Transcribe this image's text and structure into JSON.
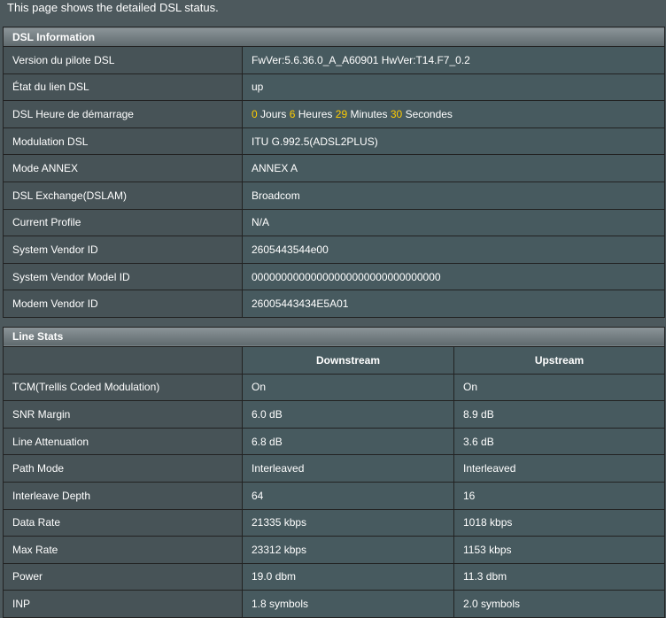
{
  "intro": "This page shows the detailed DSL status.",
  "dsl_info": {
    "title": "DSL Information",
    "rows": [
      {
        "label": "Version du pilote DSL",
        "value": "FwVer:5.6.36.0_A_A60901 HwVer:T14.F7_0.2"
      },
      {
        "label": "État du lien DSL",
        "value": "up"
      },
      {
        "label": "DSL Heure de démarrage",
        "value": ""
      },
      {
        "label": "Modulation DSL",
        "value": "ITU G.992.5(ADSL2PLUS)"
      },
      {
        "label": "Mode ANNEX",
        "value": "ANNEX A"
      },
      {
        "label": "DSL Exchange(DSLAM)",
        "value": "Broadcom"
      },
      {
        "label": "Current Profile",
        "value": "N/A"
      },
      {
        "label": "System Vendor ID",
        "value": "2605443544e00"
      },
      {
        "label": "System Vendor Model ID",
        "value": "00000000000000000000000000000000"
      },
      {
        "label": "Modem Vendor ID",
        "value": "26005443434E5A01"
      }
    ],
    "uptime": {
      "days": "0",
      "days_label": "Jours",
      "hours": "6",
      "hours_label": "Heures",
      "minutes": "29",
      "minutes_label": "Minutes",
      "seconds": "30",
      "seconds_label": "Secondes"
    }
  },
  "line_stats": {
    "title": "Line Stats",
    "col_downstream": "Downstream",
    "col_upstream": "Upstream",
    "rows": [
      {
        "label": "TCM(Trellis Coded Modulation)",
        "down": "On",
        "up": "On"
      },
      {
        "label": "SNR Margin",
        "down": "6.0 dB",
        "up": "8.9 dB"
      },
      {
        "label": "Line Attenuation",
        "down": "6.8 dB",
        "up": "3.6 dB"
      },
      {
        "label": "Path Mode",
        "down": "Interleaved",
        "up": "Interleaved"
      },
      {
        "label": "Interleave Depth",
        "down": "64",
        "up": "16"
      },
      {
        "label": "Data Rate",
        "down": "21335 kbps",
        "up": "1018 kbps"
      },
      {
        "label": "Max Rate",
        "down": "23312 kbps",
        "up": "1153 kbps"
      },
      {
        "label": "Power",
        "down": "19.0 dbm",
        "up": "11.3 dbm"
      },
      {
        "label": "INP",
        "down": "1.8 symbols",
        "up": "2.0 symbols"
      }
    ]
  },
  "colors": {
    "background": "#4d595d",
    "highlight": "#ffcc00"
  }
}
